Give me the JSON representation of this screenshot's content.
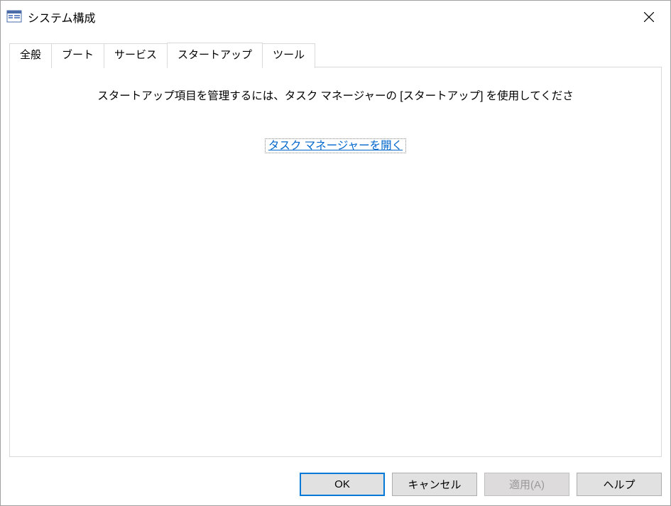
{
  "window": {
    "title": "システム構成"
  },
  "tabs": {
    "general": "全般",
    "boot": "ブート",
    "services": "サービス",
    "startup": "スタートアップ",
    "tools": "ツール"
  },
  "content": {
    "message": "スタートアップ項目を管理するには、タスク マネージャーの [スタートアップ] を使用してくださ",
    "link": "タスク マネージャーを開く"
  },
  "buttons": {
    "ok": "OK",
    "cancel": "キャンセル",
    "apply": "適用(A)",
    "help": "ヘルプ"
  }
}
